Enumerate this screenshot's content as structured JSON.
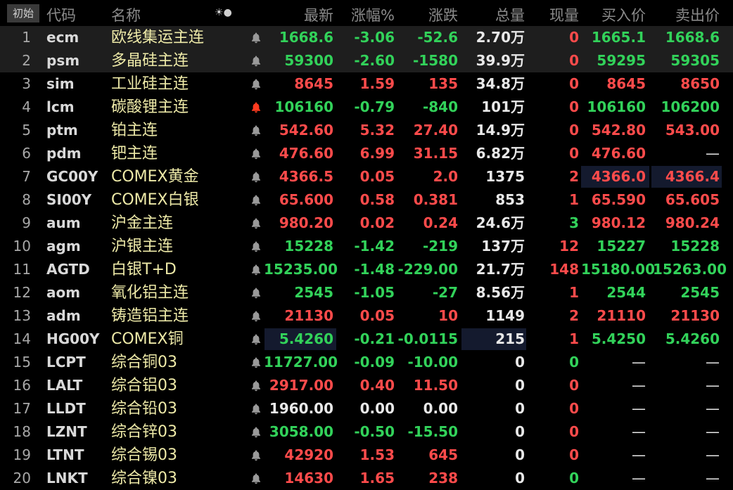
{
  "colors": {
    "up": "#ff4b4b",
    "down": "#32d25a",
    "flat": "#e8e8e8",
    "name": "#eeeaa8",
    "bell_active": "#ff3b1f"
  },
  "header": {
    "first_button": "初始",
    "code": "代码",
    "name": "名称",
    "icon_names": [
      "sun-icon",
      "dot-icon"
    ],
    "last": "最新",
    "pct": "涨幅%",
    "chg": "涨跌",
    "vol": "总量",
    "cur": "现量",
    "bid": "买入价",
    "ask": "卖出价"
  },
  "rows": [
    {
      "num": "1",
      "code": "ecm",
      "name": "欧线集运主连",
      "bell": "bell-icon",
      "last": "1668.6",
      "last_dir": "dn",
      "pct": "-3.06",
      "pct_dir": "dn",
      "chg": "-52.6",
      "chg_dir": "dn",
      "vol": "2.70万",
      "cur": "0",
      "cur_dir": "up",
      "bid": "1665.1",
      "bid_dir": "dn",
      "ask": "1668.6",
      "ask_dir": "dn"
    },
    {
      "num": "2",
      "code": "psm",
      "name": "多晶硅主连",
      "bell": "bell-icon",
      "last": "59300",
      "last_dir": "dn",
      "pct": "-2.60",
      "pct_dir": "dn",
      "chg": "-1580",
      "chg_dir": "dn",
      "vol": "39.9万",
      "cur": "0",
      "cur_dir": "up",
      "bid": "59295",
      "bid_dir": "dn",
      "ask": "59305",
      "ask_dir": "dn"
    },
    {
      "num": "3",
      "code": "sim",
      "name": "工业硅主连",
      "bell": "bell-icon",
      "last": "8645",
      "last_dir": "up",
      "pct": "1.59",
      "pct_dir": "up",
      "chg": "135",
      "chg_dir": "up",
      "vol": "34.8万",
      "cur": "0",
      "cur_dir": "up",
      "bid": "8645",
      "bid_dir": "up",
      "ask": "8650",
      "ask_dir": "up"
    },
    {
      "num": "4",
      "code": "lcm",
      "name": "碳酸锂主连",
      "bell": "bell-active-icon",
      "last": "106160",
      "last_dir": "dn",
      "pct": "-0.79",
      "pct_dir": "dn",
      "chg": "-840",
      "chg_dir": "dn",
      "vol": "101万",
      "cur": "0",
      "cur_dir": "up",
      "bid": "106160",
      "bid_dir": "dn",
      "ask": "106200",
      "ask_dir": "dn"
    },
    {
      "num": "5",
      "code": "ptm",
      "name": "铂主连",
      "bell": "bell-icon",
      "last": "542.60",
      "last_dir": "up",
      "pct": "5.32",
      "pct_dir": "up",
      "chg": "27.40",
      "chg_dir": "up",
      "vol": "14.9万",
      "cur": "0",
      "cur_dir": "up",
      "bid": "542.80",
      "bid_dir": "up",
      "ask": "543.00",
      "ask_dir": "up"
    },
    {
      "num": "6",
      "code": "pdm",
      "name": "钯主连",
      "bell": "bell-icon",
      "last": "476.60",
      "last_dir": "up",
      "pct": "6.99",
      "pct_dir": "up",
      "chg": "31.15",
      "chg_dir": "up",
      "vol": "6.82万",
      "cur": "0",
      "cur_dir": "up",
      "bid": "476.60",
      "bid_dir": "up",
      "ask": "—",
      "ask_dir": "dash"
    },
    {
      "num": "7",
      "code": "GC00Y",
      "name": "COMEX黄金",
      "bell": "bell-icon",
      "last": "4366.5",
      "last_dir": "up",
      "pct": "0.05",
      "pct_dir": "up",
      "chg": "2.0",
      "chg_dir": "up",
      "vol": "1375",
      "cur": "2",
      "cur_dir": "up",
      "bid": "4366.0",
      "bid_dir": "up",
      "ask": "4366.4",
      "ask_dir": "up"
    },
    {
      "num": "8",
      "code": "SI00Y",
      "name": "COMEX白银",
      "bell": "bell-icon",
      "last": "65.600",
      "last_dir": "up",
      "pct": "0.58",
      "pct_dir": "up",
      "chg": "0.381",
      "chg_dir": "up",
      "vol": "853",
      "cur": "1",
      "cur_dir": "up",
      "bid": "65.590",
      "bid_dir": "up",
      "ask": "65.605",
      "ask_dir": "up"
    },
    {
      "num": "9",
      "code": "aum",
      "name": "沪金主连",
      "bell": "bell-icon",
      "last": "980.20",
      "last_dir": "up",
      "pct": "0.02",
      "pct_dir": "up",
      "chg": "0.24",
      "chg_dir": "up",
      "vol": "24.6万",
      "cur": "3",
      "cur_dir": "dn",
      "bid": "980.12",
      "bid_dir": "up",
      "ask": "980.24",
      "ask_dir": "up"
    },
    {
      "num": "10",
      "code": "agm",
      "name": "沪银主连",
      "bell": "bell-icon",
      "last": "15228",
      "last_dir": "dn",
      "pct": "-1.42",
      "pct_dir": "dn",
      "chg": "-219",
      "chg_dir": "dn",
      "vol": "137万",
      "cur": "12",
      "cur_dir": "up",
      "bid": "15227",
      "bid_dir": "dn",
      "ask": "15228",
      "ask_dir": "dn"
    },
    {
      "num": "11",
      "code": "AGTD",
      "name": "白银T+D",
      "bell": "bell-icon",
      "last": "15235.00",
      "last_dir": "dn",
      "pct": "-1.48",
      "pct_dir": "dn",
      "chg": "-229.00",
      "chg_dir": "dn",
      "vol": "21.7万",
      "cur": "148",
      "cur_dir": "up",
      "bid": "15180.00",
      "bid_dir": "dn",
      "ask": "15263.00",
      "ask_dir": "dn"
    },
    {
      "num": "12",
      "code": "aom",
      "name": "氧化铝主连",
      "bell": "bell-icon",
      "last": "2545",
      "last_dir": "dn",
      "pct": "-1.05",
      "pct_dir": "dn",
      "chg": "-27",
      "chg_dir": "dn",
      "vol": "8.56万",
      "cur": "1",
      "cur_dir": "up",
      "bid": "2544",
      "bid_dir": "dn",
      "ask": "2545",
      "ask_dir": "dn"
    },
    {
      "num": "13",
      "code": "adm",
      "name": "铸造铝主连",
      "bell": "bell-icon",
      "last": "21130",
      "last_dir": "up",
      "pct": "0.05",
      "pct_dir": "up",
      "chg": "10",
      "chg_dir": "up",
      "vol": "1149",
      "cur": "2",
      "cur_dir": "up",
      "bid": "21110",
      "bid_dir": "up",
      "ask": "21130",
      "ask_dir": "up"
    },
    {
      "num": "14",
      "code": "HG00Y",
      "name": "COMEX铜",
      "bell": "bell-icon",
      "last": "5.4260",
      "last_dir": "dn",
      "pct": "-0.21",
      "pct_dir": "dn",
      "chg": "-0.0115",
      "chg_dir": "dn",
      "vol": "215",
      "cur": "1",
      "cur_dir": "up",
      "bid": "5.4250",
      "bid_dir": "dn",
      "ask": "5.4260",
      "ask_dir": "dn"
    },
    {
      "num": "15",
      "code": "LCPT",
      "name": "综合铜03",
      "bell": "bell-icon",
      "last": "11727.00",
      "last_dir": "dn",
      "pct": "-0.09",
      "pct_dir": "dn",
      "chg": "-10.00",
      "chg_dir": "dn",
      "vol": "0",
      "cur": "0",
      "cur_dir": "dn",
      "bid": "—",
      "bid_dir": "dash",
      "ask": "—",
      "ask_dir": "dash"
    },
    {
      "num": "16",
      "code": "LALT",
      "name": "综合铝03",
      "bell": "bell-icon",
      "last": "2917.00",
      "last_dir": "up",
      "pct": "0.40",
      "pct_dir": "up",
      "chg": "11.50",
      "chg_dir": "up",
      "vol": "0",
      "cur": "0",
      "cur_dir": "up",
      "bid": "—",
      "bid_dir": "dash",
      "ask": "—",
      "ask_dir": "dash"
    },
    {
      "num": "17",
      "code": "LLDT",
      "name": "综合铅03",
      "bell": "bell-icon",
      "last": "1960.00",
      "last_dir": "fl",
      "pct": "0.00",
      "pct_dir": "fl",
      "chg": "0.00",
      "chg_dir": "fl",
      "vol": "0",
      "cur": "0",
      "cur_dir": "up",
      "bid": "—",
      "bid_dir": "dash",
      "ask": "—",
      "ask_dir": "dash"
    },
    {
      "num": "18",
      "code": "LZNT",
      "name": "综合锌03",
      "bell": "bell-icon",
      "last": "3058.00",
      "last_dir": "dn",
      "pct": "-0.50",
      "pct_dir": "dn",
      "chg": "-15.50",
      "chg_dir": "dn",
      "vol": "0",
      "cur": "0",
      "cur_dir": "up",
      "bid": "—",
      "bid_dir": "dash",
      "ask": "—",
      "ask_dir": "dash"
    },
    {
      "num": "19",
      "code": "LTNT",
      "name": "综合锡03",
      "bell": "bell-icon",
      "last": "42920",
      "last_dir": "up",
      "pct": "1.53",
      "pct_dir": "up",
      "chg": "645",
      "chg_dir": "up",
      "vol": "0",
      "cur": "0",
      "cur_dir": "up",
      "bid": "—",
      "bid_dir": "dash",
      "ask": "—",
      "ask_dir": "dash"
    },
    {
      "num": "20",
      "code": "LNKT",
      "name": "综合镍03",
      "bell": "bell-icon",
      "last": "14630",
      "last_dir": "up",
      "pct": "1.65",
      "pct_dir": "up",
      "chg": "238",
      "chg_dir": "up",
      "vol": "0",
      "cur": "0",
      "cur_dir": "dn",
      "bid": "—",
      "bid_dir": "dash",
      "ask": "—",
      "ask_dir": "dash"
    }
  ]
}
